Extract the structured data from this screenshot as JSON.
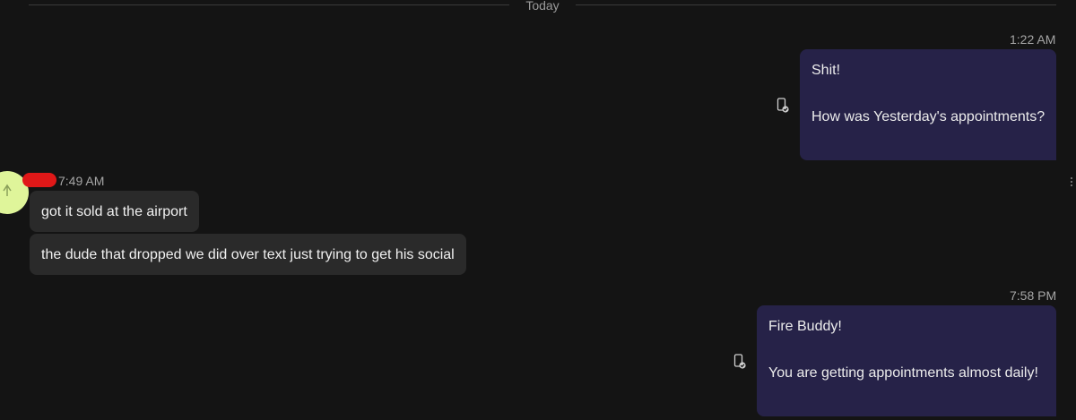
{
  "divider": {
    "label": "Today"
  },
  "messages": [
    {
      "direction": "outgoing",
      "time": "1:22 AM",
      "lines": [
        "Shit!",
        "How was Yesterday's appointments?"
      ]
    },
    {
      "direction": "incoming",
      "time": "7:49 AM",
      "sender_redacted": true,
      "bubbles": [
        "got it sold at the airport",
        "the dude that dropped we did over text just trying to get his social"
      ]
    },
    {
      "direction": "outgoing",
      "time": "7:58 PM",
      "lines": [
        "Fire Buddy!",
        "You are getting appointments almost daily!"
      ]
    }
  ],
  "colors": {
    "background": "#141414",
    "outgoing_bubble": "#262248",
    "incoming_bubble": "#2a2a2a",
    "avatar": "#dff59a",
    "redaction": "#e01818"
  },
  "icons": {
    "read_receipt": "phone-check-icon",
    "avatar": "avatar-icon",
    "more": "more-vertical-icon"
  }
}
